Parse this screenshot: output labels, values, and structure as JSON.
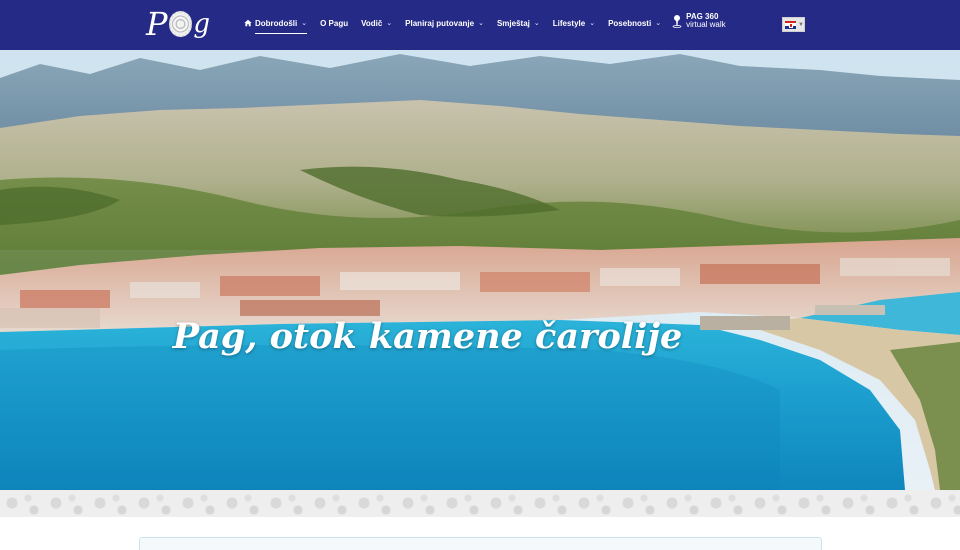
{
  "header": {
    "logo": {
      "text_left": "P",
      "text_right": "g"
    },
    "nav": [
      {
        "label": "Dobrodošli",
        "active": true
      },
      {
        "label": "O Pagu"
      },
      {
        "label": "Vodič"
      },
      {
        "label": "Planiraj putovanje"
      },
      {
        "label": "Smještaj"
      },
      {
        "label": "Lifestyle"
      },
      {
        "label": "Posebnosti"
      }
    ],
    "pag360": {
      "line1": "PAG 360",
      "line2": "virtual walk"
    },
    "language": {
      "current": "hr-flag"
    }
  },
  "hero": {
    "title": "Pag, otok kamene čarolije"
  },
  "colors": {
    "header_bg": "#242a86",
    "sea": "#1fa6d6",
    "text": "#ffffff"
  },
  "icons": {
    "home": "home-icon",
    "pin": "map-pin-icon",
    "chevron": "chevron-down-icon"
  }
}
